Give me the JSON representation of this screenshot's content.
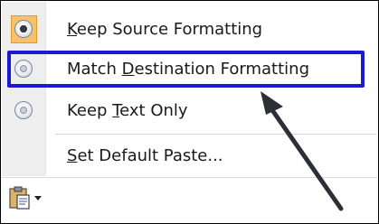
{
  "menu": {
    "items": [
      {
        "pre": "",
        "accel": "K",
        "post": "eep Source Formatting",
        "checked": true
      },
      {
        "pre": "Match ",
        "accel": "D",
        "post": "estination Formatting",
        "checked": false
      },
      {
        "pre": "Keep ",
        "accel": "T",
        "post": "ext Only",
        "checked": false
      },
      {
        "pre": "",
        "accel": "S",
        "post": "et Default Paste...",
        "checked": false
      }
    ]
  },
  "icons": {
    "radio": "radio-icon",
    "paste": "paste-clipboard-icon",
    "dropdown": "chevron-down-icon",
    "annotation": "arrow-annotation"
  },
  "colors": {
    "highlight_border": "#1a1ad2",
    "checked_background": "#f7c26b",
    "gutter": "#eeeeef"
  }
}
